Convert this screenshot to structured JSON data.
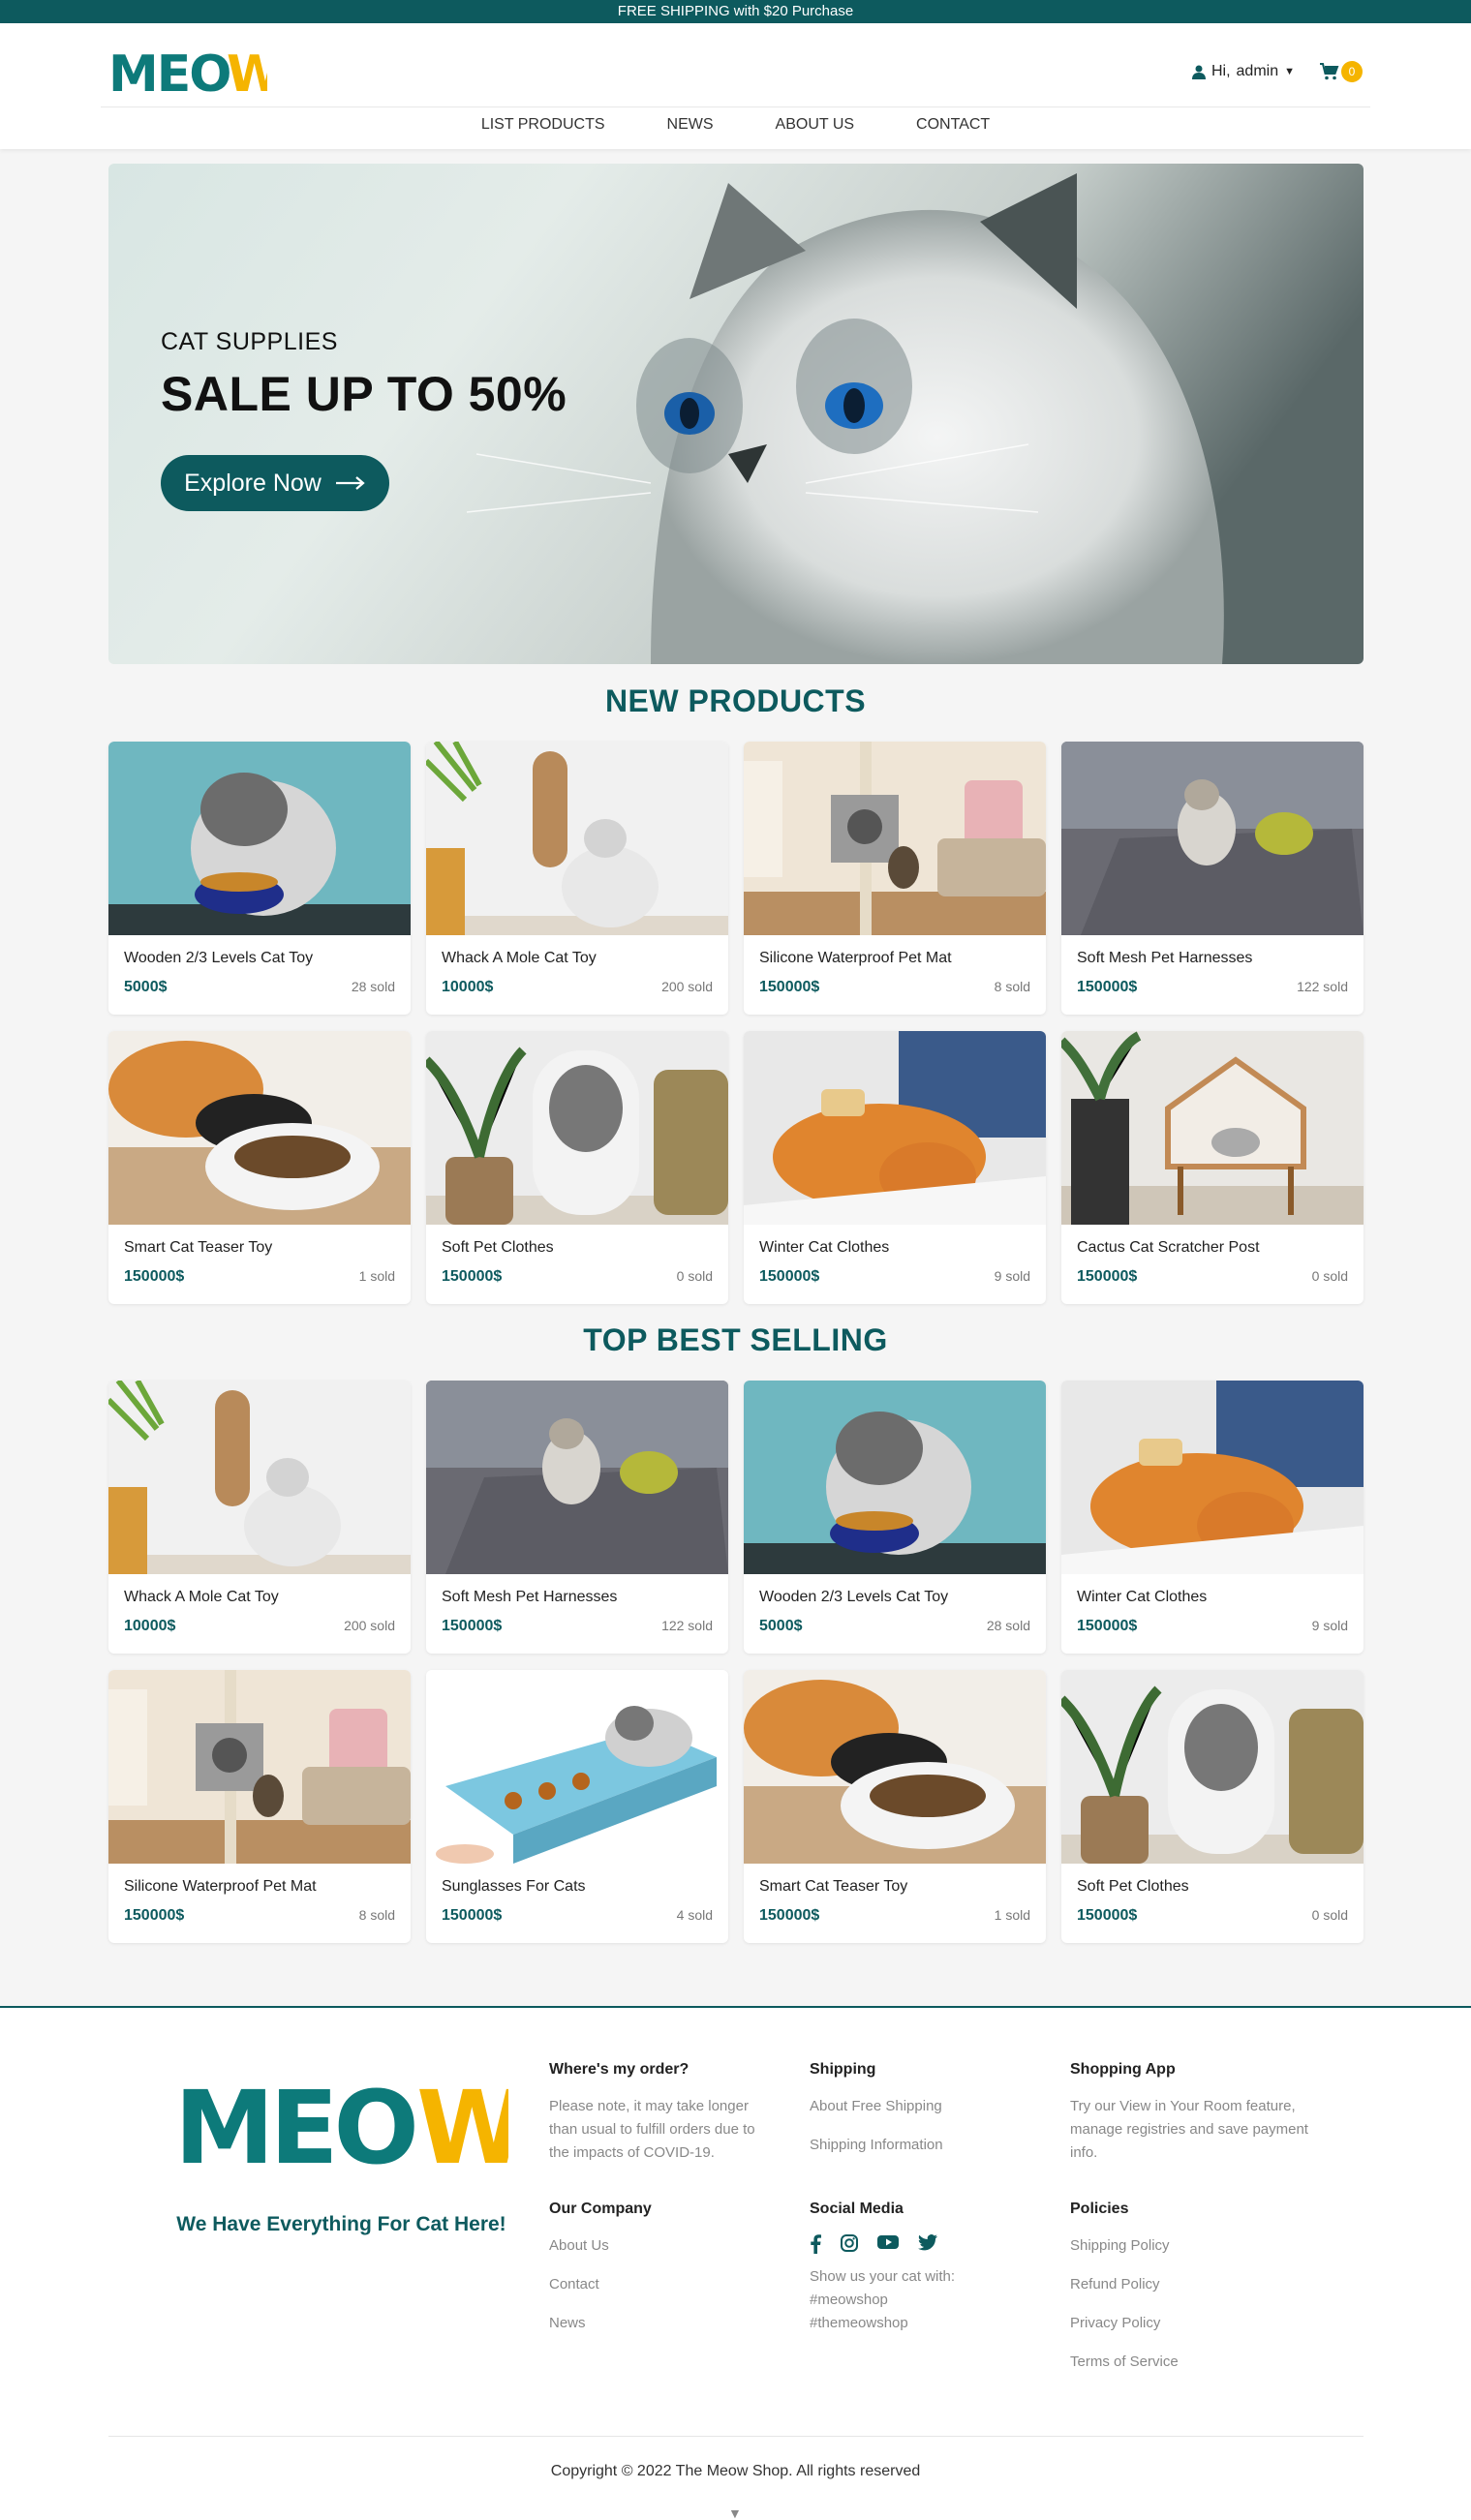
{
  "topbar": {
    "text": "FREE SHIPPING with $20 Purchase"
  },
  "header": {
    "logo_text": "MEOW",
    "greeting": "Hi,",
    "username": "admin",
    "cart_count": "0"
  },
  "nav": {
    "items": [
      "LIST PRODUCTS",
      "NEWS",
      "ABOUT US",
      "CONTACT"
    ]
  },
  "hero": {
    "subtitle": "CAT SUPPLIES",
    "title": "SALE UP TO 50%",
    "button": "Explore Now"
  },
  "new_products": {
    "title": "NEW PRODUCTS",
    "items": [
      {
        "name": "Wooden 2/3 Levels Cat Toy",
        "price": "5000$",
        "sold": "28 sold"
      },
      {
        "name": "Whack A Mole Cat Toy",
        "price": "10000$",
        "sold": "200 sold"
      },
      {
        "name": "Silicone Waterproof Pet Mat",
        "price": "150000$",
        "sold": "8 sold"
      },
      {
        "name": "Soft Mesh Pet Harnesses",
        "price": "150000$",
        "sold": "122 sold"
      },
      {
        "name": "Smart Cat Teaser Toy",
        "price": "150000$",
        "sold": "1 sold"
      },
      {
        "name": "Soft Pet Clothes",
        "price": "150000$",
        "sold": "0 sold"
      },
      {
        "name": "Winter Cat Clothes",
        "price": "150000$",
        "sold": "9 sold"
      },
      {
        "name": "Cactus Cat Scratcher Post",
        "price": "150000$",
        "sold": "0 sold"
      }
    ]
  },
  "best_selling": {
    "title": "TOP BEST SELLING",
    "items": [
      {
        "name": "Whack A Mole Cat Toy",
        "price": "10000$",
        "sold": "200 sold"
      },
      {
        "name": "Soft Mesh Pet Harnesses",
        "price": "150000$",
        "sold": "122 sold"
      },
      {
        "name": "Wooden 2/3 Levels Cat Toy",
        "price": "5000$",
        "sold": "28 sold"
      },
      {
        "name": "Winter Cat Clothes",
        "price": "150000$",
        "sold": "9 sold"
      },
      {
        "name": "Silicone Waterproof Pet Mat",
        "price": "150000$",
        "sold": "8 sold"
      },
      {
        "name": "Sunglasses For Cats",
        "price": "150000$",
        "sold": "4 sold"
      },
      {
        "name": "Smart Cat Teaser Toy",
        "price": "150000$",
        "sold": "1 sold"
      },
      {
        "name": "Soft Pet Clothes",
        "price": "150000$",
        "sold": "0 sold"
      }
    ]
  },
  "footer": {
    "tagline": "We Have Everything For Cat Here!",
    "where_title": "Where's my order?",
    "where_text": "Please note, it may take longer than usual to fulfill orders due to the impacts of COVID-19.",
    "company_title": "Our Company",
    "company_links": [
      "About Us",
      "Contact",
      "News"
    ],
    "shipping_title": "Shipping",
    "shipping_links": [
      "About Free Shipping",
      "Shipping Information"
    ],
    "social_title": "Social Media",
    "social_text_1": "Show us your cat with:",
    "social_text_2": "#meowshop",
    "social_text_3": "#themeowshop",
    "app_title": "Shopping App",
    "app_text": "Try our View in Your Room feature, manage registries and save payment info.",
    "policies_title": "Policies",
    "policies_links": [
      "Shipping Policy",
      "Refund Policy",
      "Privacy Policy",
      "Terms of Service"
    ],
    "copyright": "Copyright © 2022 The Meow Shop. All rights reserved"
  },
  "colors": {
    "brand": "#0d5a5e",
    "accent": "#f5b400",
    "background": "#f5f5f5"
  }
}
